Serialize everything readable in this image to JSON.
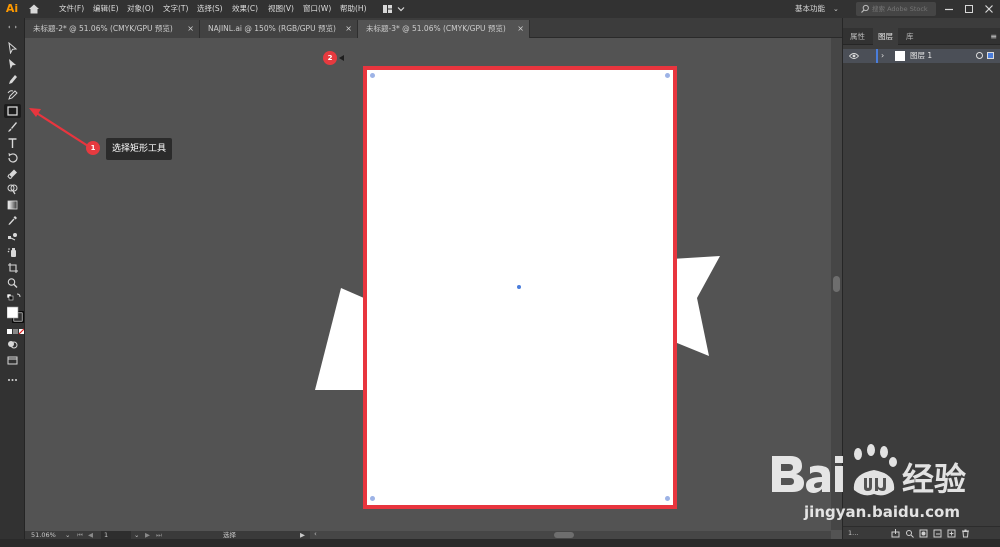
{
  "app": {
    "logo": "Ai"
  },
  "menu": {
    "items": [
      "文件(F)",
      "编辑(E)",
      "对象(O)",
      "文字(T)",
      "选择(S)",
      "效果(C)",
      "视图(V)",
      "窗口(W)",
      "帮助(H)"
    ]
  },
  "workspace": {
    "label": "基本功能"
  },
  "stock_search": {
    "placeholder": "搜索 Adobe Stock"
  },
  "tabs": [
    {
      "label": "未标题-2* @ 51.06% (CMYK/GPU 预览)",
      "close": "×",
      "active": false
    },
    {
      "label": "NAJINL.ai @ 150% (RGB/GPU 预览)",
      "close": "×",
      "active": false
    },
    {
      "label": "未标题-3* @ 51.06% (CMYK/GPU 预览)",
      "close": "×",
      "active": true
    }
  ],
  "tools": [
    "selection-tool",
    "direct-selection-tool",
    "pen-tool",
    "curvature-tool",
    "rectangle-tool",
    "paintbrush-tool",
    "type-tool",
    "rotate-tool",
    "eraser-tool",
    "shape-builder-tool",
    "gradient-tool",
    "eyedropper-tool",
    "blend-tool",
    "symbol-sprayer-tool",
    "artboard-tool",
    "zoom-tool",
    "fill-stroke-swap",
    "color-mode",
    "draw-mode",
    "screen-mode",
    "more-tools"
  ],
  "annotations": {
    "step1": {
      "number": "1",
      "text": "选择矩形工具"
    },
    "step2": {
      "number": "2"
    }
  },
  "status": {
    "zoom": "51.06%",
    "artboard_nav": "1",
    "tool_name": "选择"
  },
  "panel": {
    "tabs": [
      "属性",
      "图层",
      "库"
    ],
    "active_tab": "图层",
    "menu": "≡",
    "layer": {
      "name": "图层 1",
      "color": "#4a7ddb"
    },
    "footer_label": "1..."
  },
  "colors": {
    "accent_red": "#e8353e",
    "artboard": "#ffffff",
    "canvas_bg": "#535353",
    "selection_blue": "#9db3e6"
  },
  "watermark": {
    "brand": "Bai经验",
    "url": "jingyan.baidu.com"
  }
}
